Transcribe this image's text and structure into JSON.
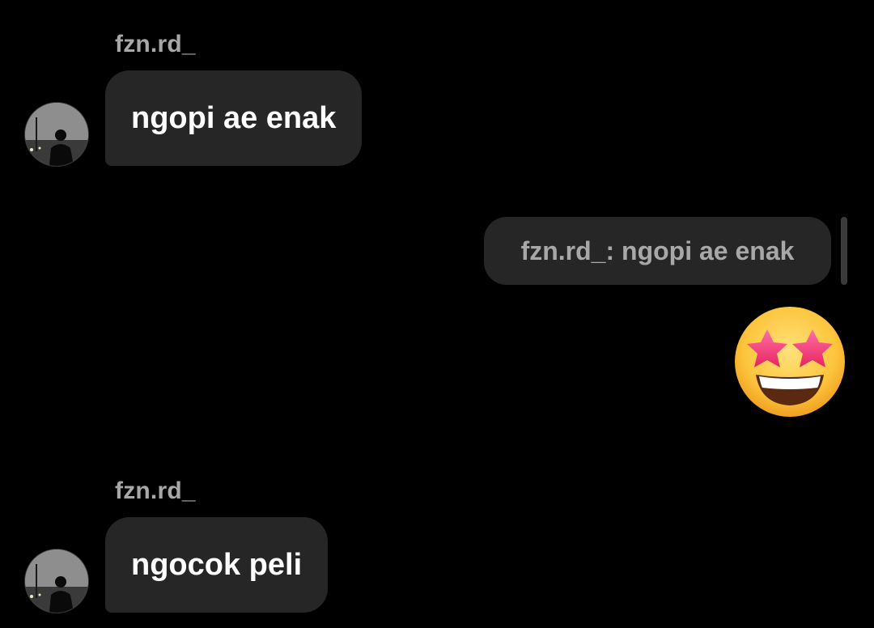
{
  "thread": {
    "messages": [
      {
        "sender": "fzn.rd_",
        "text": "ngopi ae enak"
      },
      {
        "reply_preview": "fzn.rd_: ngopi ae enak",
        "emoji_name": "star-struck-emoji"
      },
      {
        "sender": "fzn.rd_",
        "text": "ngocok peli"
      }
    ]
  },
  "colors": {
    "background": "#000000",
    "incoming_bubble": "#262626",
    "sender_name": "#a8a8a8",
    "text": "#ffffff"
  }
}
